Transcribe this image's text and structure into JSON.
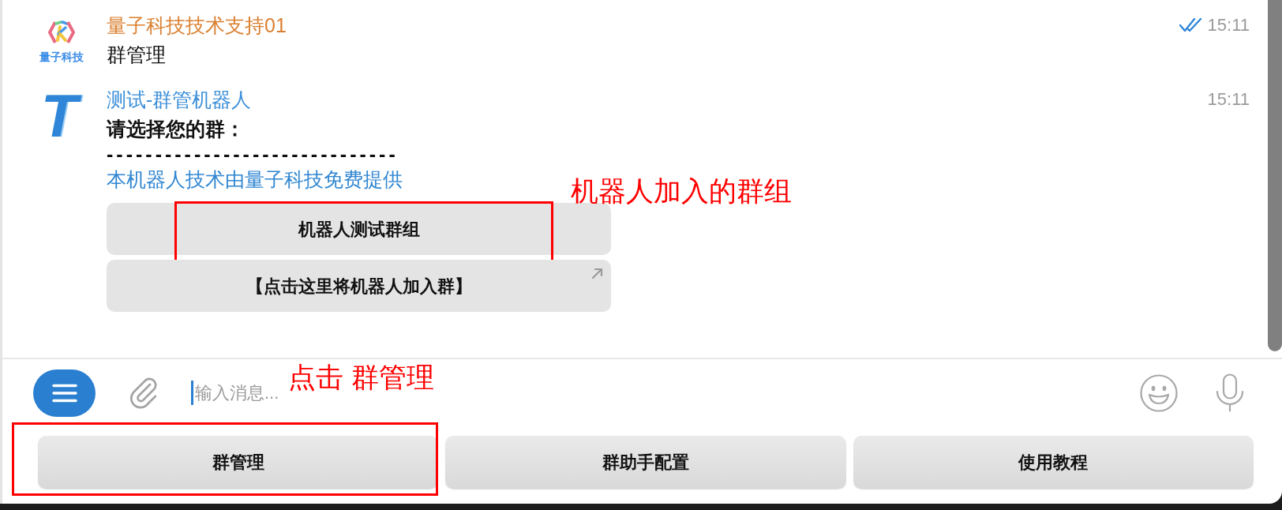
{
  "messages": [
    {
      "sender": "量子科技技术支持01",
      "color": "#da7f2f",
      "avatar": {
        "kind": "logo",
        "caption": "量子科技"
      },
      "time": "15:11",
      "read": true,
      "lines": [
        {
          "kind": "plain",
          "text": "群管理"
        }
      ]
    },
    {
      "sender": "测试-群管机器人",
      "color": "#3a8ed8",
      "avatar": {
        "kind": "letter",
        "text": "T"
      },
      "time": "15:11",
      "read": false,
      "lines": [
        {
          "kind": "bold",
          "text": "请选择您的群："
        },
        {
          "kind": "rule",
          "text": "------------------------------"
        },
        {
          "kind": "link",
          "text": "本机器人技术由量子科技免费提供"
        }
      ],
      "buttons": [
        {
          "label": "机器人测试群组",
          "external": false,
          "highlighted": true
        },
        {
          "label": "【点击这里将机器人加入群】",
          "external": true,
          "highlighted": false
        }
      ],
      "note": "机器人加入的群组"
    }
  ],
  "composer": {
    "placeholder": "输入消息...",
    "note": "点击 群管理"
  },
  "keyboard": [
    {
      "label": "群管理",
      "highlighted": true
    },
    {
      "label": "群助手配置",
      "highlighted": false
    },
    {
      "label": "使用教程",
      "highlighted": false
    }
  ]
}
